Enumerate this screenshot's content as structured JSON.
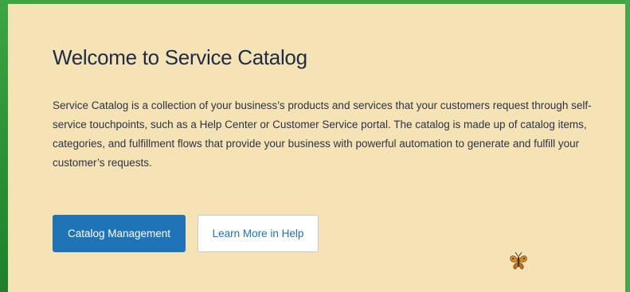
{
  "welcome": {
    "title": "Welcome to Service Catalog",
    "description": "Service Catalog is a collection of your business’s products and services that your customers request through self-service touchpoints, such as a Help Center or Customer Service portal. The catalog is made up of catalog items, categories, and fulfillment flows that provide your business with powerful automation to generate and fulfill your customer’s requests."
  },
  "actions": {
    "primary_label": "Catalog Management",
    "secondary_label": "Learn More in Help"
  },
  "decorations": {
    "butterfly_icon": "butterfly-icon"
  },
  "colors": {
    "panel_background": "#f5e3b5",
    "frame_green": "#2f9a3a",
    "primary_blue": "#1f73b7",
    "title_text": "#1f2b46"
  }
}
